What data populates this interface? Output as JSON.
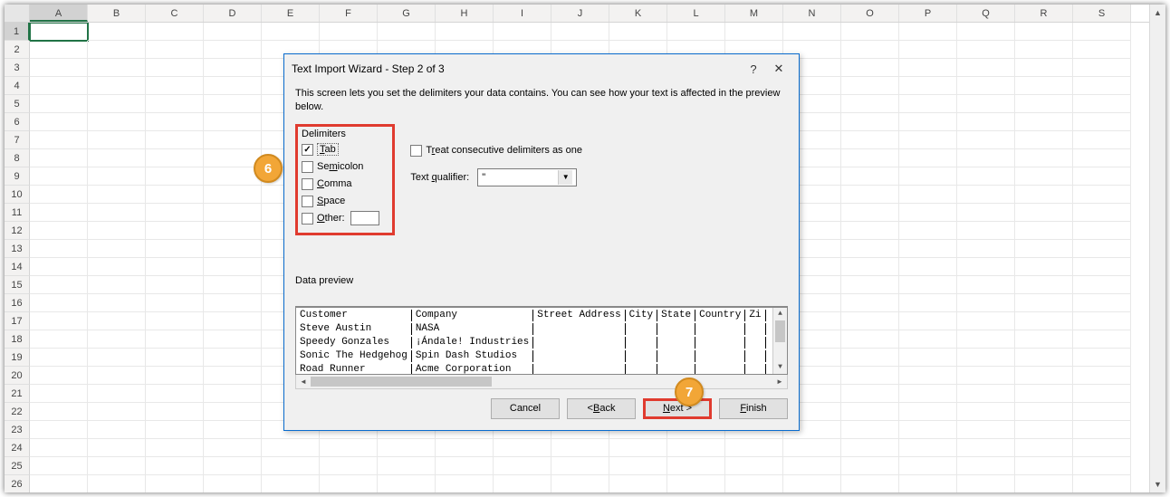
{
  "columns": [
    "A",
    "B",
    "C",
    "D",
    "E",
    "F",
    "G",
    "H",
    "I",
    "J",
    "K",
    "L",
    "M",
    "N",
    "O",
    "P",
    "Q",
    "R",
    "S"
  ],
  "row_count": 26,
  "selected": {
    "col": "A",
    "row": 1
  },
  "dialog": {
    "title": "Text Import Wizard - Step 2 of 3",
    "help_icon": "?",
    "close_icon": "✕",
    "description": "This screen lets you set the delimiters your data contains.  You can see how your text is affected in the preview below.",
    "delimiters": {
      "group_label": "Delimiters",
      "tab": "Tab",
      "semicolon": "Semicolon",
      "comma": "Comma",
      "space": "Space",
      "other": "Other:",
      "tab_checked": "true"
    },
    "treat_consecutive": "Treat consecutive delimiters as one",
    "qualifier_label": "Text qualifier:",
    "qualifier_value": "\"",
    "preview_label": "Data preview",
    "buttons": {
      "cancel": "Cancel",
      "back": "< Back",
      "next": "Next >",
      "finish": "Finish"
    }
  },
  "preview": {
    "headers": [
      "Customer",
      "Company",
      "Street Address",
      "City",
      "State",
      "Country",
      "Zi"
    ],
    "rows": [
      [
        "Steve Austin",
        "NASA",
        "",
        "",
        "",
        "",
        ""
      ],
      [
        "Speedy Gonzales",
        "¡Ándale! Industries",
        "",
        "",
        "",
        "",
        ""
      ],
      [
        "Sonic The Hedgehog",
        "Spin Dash Studios",
        "",
        "",
        "",
        "",
        ""
      ],
      [
        "Road Runner",
        "Acme Corporation",
        "",
        "",
        "",
        "",
        ""
      ]
    ]
  },
  "callouts": {
    "c6": "6",
    "c7": "7"
  }
}
